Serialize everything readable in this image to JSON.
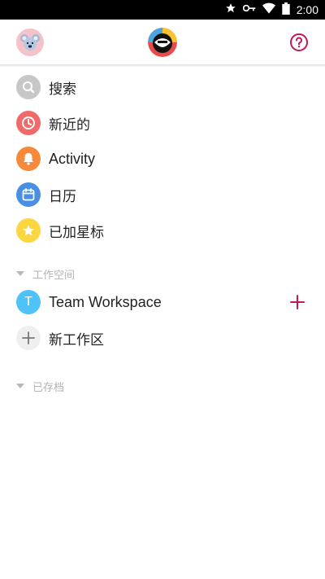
{
  "status": {
    "time": "2:00"
  },
  "header": {
    "avatar_icon": "koala-avatar-icon",
    "logo_icon": "app-logo-icon",
    "help_icon": "help-circle-icon"
  },
  "menu": [
    {
      "label": "搜索",
      "icon": "search-icon",
      "color": "#c7c7c7"
    },
    {
      "label": "新近的",
      "icon": "clock-icon",
      "color": "#f06a6a"
    },
    {
      "label": "Activity",
      "icon": "bell-icon",
      "color": "#f58a3a"
    },
    {
      "label": "日历",
      "icon": "calendar-icon",
      "color": "#4a8fe2"
    },
    {
      "label": "已加星标",
      "icon": "star-icon",
      "color": "#fbd641"
    }
  ],
  "workspaces": {
    "section_label": "工作空间",
    "items": [
      {
        "letter": "T",
        "label": "Team Workspace",
        "color": "#4fc3f7"
      }
    ],
    "new_label": "新工作区"
  },
  "archived": {
    "section_label": "已存档"
  },
  "colors": {
    "accent": "#c2185b",
    "muted": "#b3b3b3"
  }
}
